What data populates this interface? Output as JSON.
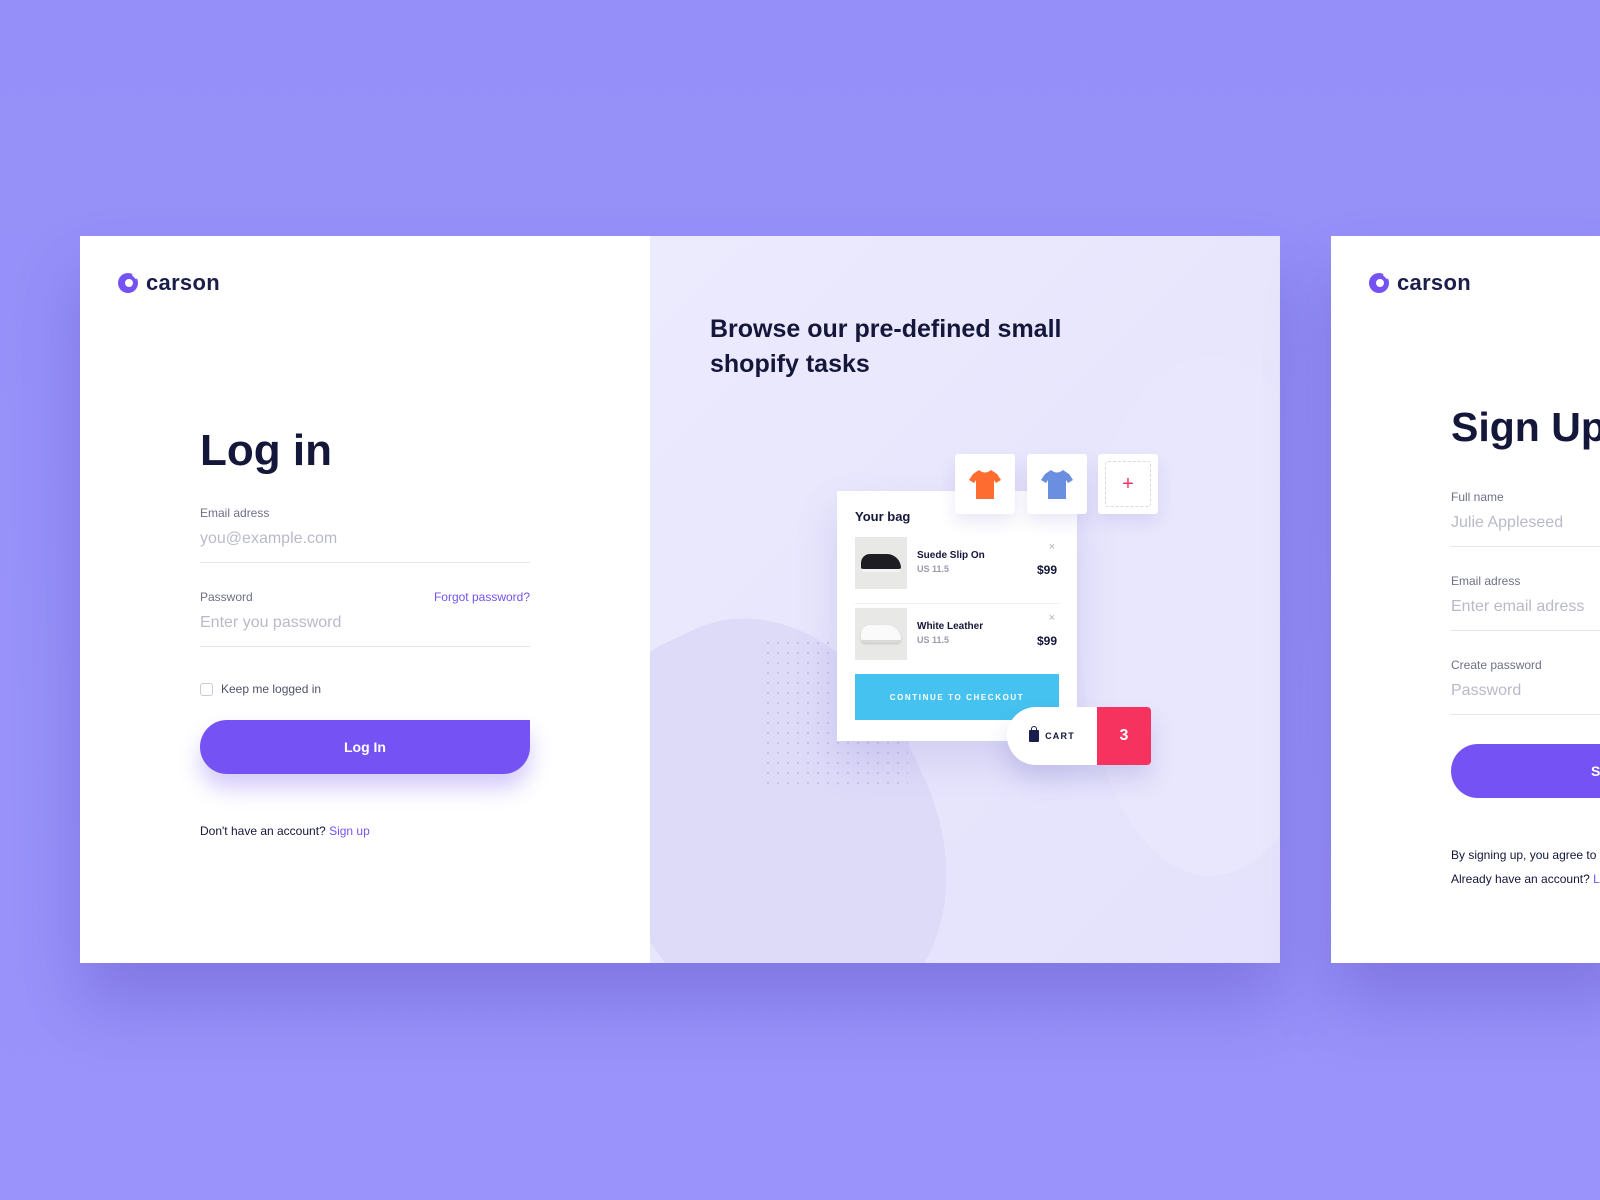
{
  "brand": {
    "name": "carson",
    "accent": "#7452f3"
  },
  "login": {
    "title": "Log in",
    "email_label": "Email adress",
    "email_placeholder": "you@example.com",
    "password_label": "Password",
    "password_placeholder": "Enter you password",
    "forgot_label": "Forgot password?",
    "remember_label": "Keep me logged in",
    "submit_label": "Log In",
    "no_account_text": "Don't have an account?",
    "signup_link": "Sign up"
  },
  "promo": {
    "title": "Browse our pre-defined small shopify tasks",
    "tiles": [
      {
        "icon": "orange-tshirt-icon",
        "color": "#ff6c2f"
      },
      {
        "icon": "blue-tshirt-icon",
        "color": "#6b8fe0"
      },
      {
        "icon": "add-icon",
        "symbol": "+"
      }
    ],
    "bag": {
      "title": "Your bag",
      "items": [
        {
          "name": "Suede Slip On",
          "size": "US 11.5",
          "price": "$99",
          "remove": "×"
        },
        {
          "name": "White Leather",
          "size": "US 11.5",
          "price": "$99",
          "remove": "×"
        }
      ],
      "checkout_label": "CONTINUE TO CHECKOUT"
    },
    "cart": {
      "label": "CART",
      "count": "3",
      "count_color": "#f6325e"
    },
    "checkout_color": "#45c2ef"
  },
  "signup": {
    "title": "Sign Up",
    "fullname_label": "Full name",
    "fullname_placeholder": "Julie Appleseed",
    "email_label": "Email adress",
    "email_placeholder": "Enter email adress",
    "password_label": "Create password",
    "password_placeholder": "Password",
    "submit_label": "S",
    "terms_text": "By signing up, you agree to",
    "have_account_text": "Already have an account?",
    "login_link": "L"
  }
}
